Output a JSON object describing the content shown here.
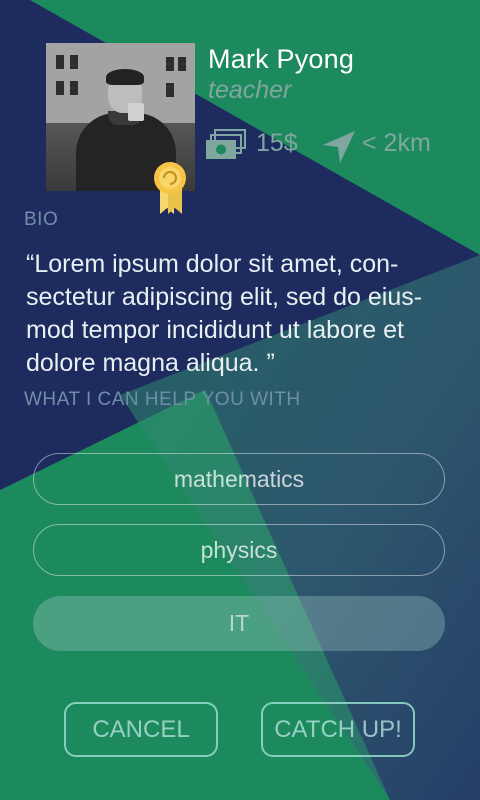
{
  "profile": {
    "name": "Mark Pyong",
    "role": "teacher",
    "price": "15$",
    "distance": "< 2km",
    "icons": [
      "money-icon",
      "navigation-icon",
      "award-badge-icon"
    ]
  },
  "bio": {
    "title": "BIO",
    "lines": [
      "“Lorem ipsum dolor sit amet, con-",
      "sectetur adipiscing elit, sed do eius-",
      "mod tempor incididunt ut labore et",
      "dolore magna aliqua. ”"
    ]
  },
  "help": {
    "title": "WHAT I CAN HELP YOU WITH",
    "subjects": [
      "mathematics",
      "physics",
      "IT"
    ]
  },
  "actions": {
    "cancel": "CANCEL",
    "catch_up": "CATCH UP!"
  },
  "colors": {
    "navy": "#1e2b5e",
    "green": "#1d8a5e",
    "muted_text": "#7fa7a0",
    "button_border": "#96dccd"
  }
}
